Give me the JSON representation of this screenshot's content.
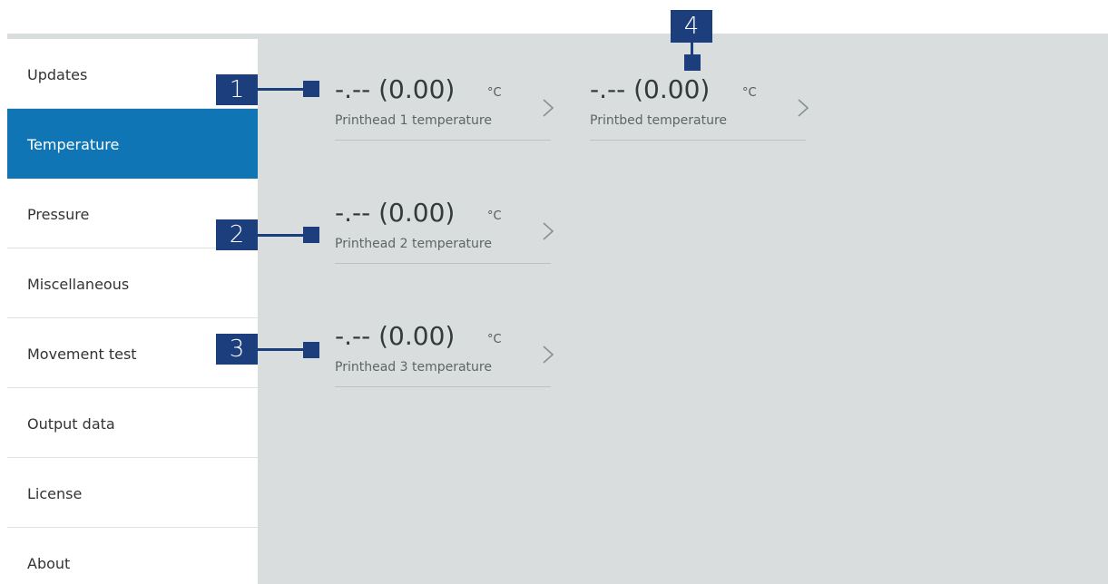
{
  "sidebar": {
    "items": [
      {
        "label": "Updates",
        "active": false
      },
      {
        "label": "Temperature",
        "active": true
      },
      {
        "label": "Pressure",
        "active": false
      },
      {
        "label": "Miscellaneous",
        "active": false
      },
      {
        "label": "Movement test",
        "active": false
      },
      {
        "label": "Output data",
        "active": false
      },
      {
        "label": "License",
        "active": false
      },
      {
        "label": "About",
        "active": false
      }
    ]
  },
  "tiles": [
    {
      "value": "-.-- (0.00)",
      "unit": "°C",
      "label": "Printhead 1 temperature",
      "icon": "chevron-right-icon"
    },
    {
      "value": "-.-- (0.00)",
      "unit": "°C",
      "label": "Printbed temperature",
      "icon": "chevron-right-icon"
    },
    {
      "value": "-.-- (0.00)",
      "unit": "°C",
      "label": "Printhead 2 temperature",
      "icon": "chevron-right-icon"
    },
    {
      "value": "-.-- (0.00)",
      "unit": "°C",
      "label": "Printhead 3 temperature",
      "icon": "chevron-right-icon"
    }
  ],
  "callouts": [
    "1",
    "2",
    "3",
    "4"
  ],
  "colors": {
    "accent": "#0f75b5",
    "callout": "#1d3e7c",
    "panel_bg": "#d9dddd"
  }
}
